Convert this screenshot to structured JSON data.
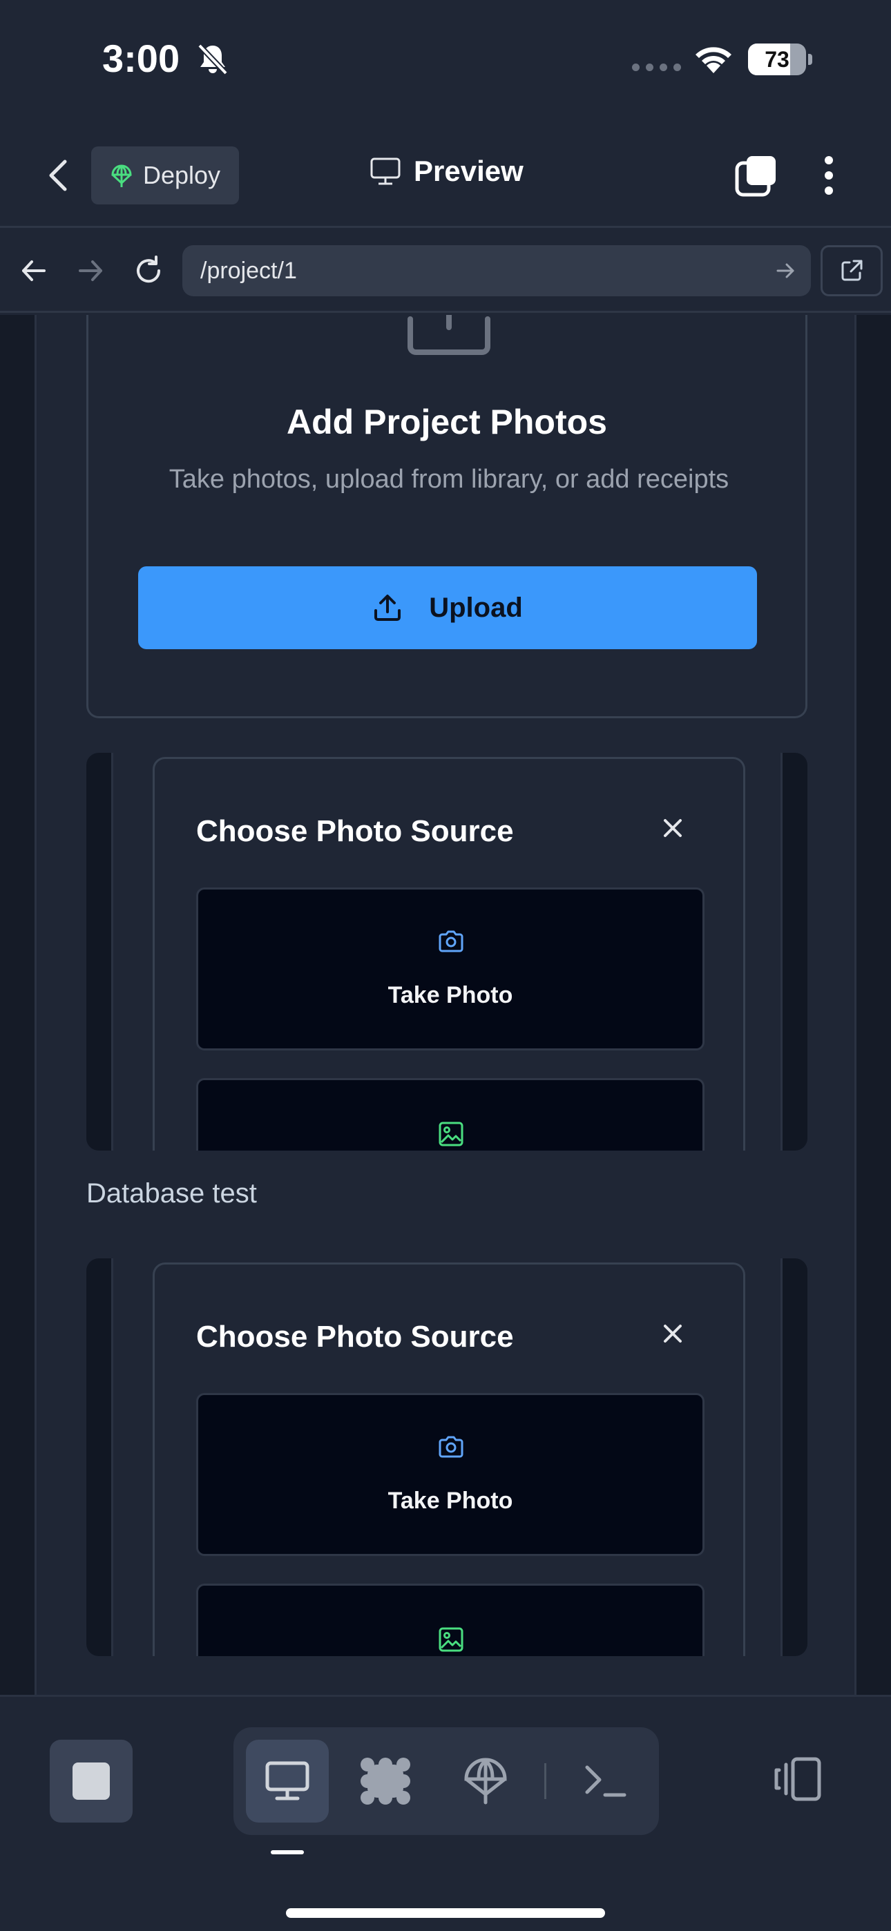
{
  "status_bar": {
    "time": "3:00",
    "battery_percent": "73",
    "battery_level": 0.73
  },
  "header": {
    "deploy_label": "Deploy",
    "title": "Preview"
  },
  "browser": {
    "url": "/project/1"
  },
  "upload_section": {
    "title": "Add Project Photos",
    "subtitle": "Take photos, upload from library, or add receipts",
    "button_label": "Upload"
  },
  "photo_source_modals": [
    {
      "title": "Choose Photo Source",
      "options": [
        {
          "label": "Take Photo",
          "icon": "camera-icon"
        },
        {
          "label": "",
          "icon": "image-icon"
        }
      ]
    },
    {
      "title": "Choose Photo Source",
      "options": [
        {
          "label": "Take Photo",
          "icon": "camera-icon"
        },
        {
          "label": "",
          "icon": "image-icon"
        }
      ]
    }
  ],
  "section_label": "Database test",
  "colors": {
    "accent": "#3b98fb",
    "background": "#1f2635",
    "option_bg": "#030816",
    "camera_icon": "#60a5fa",
    "image_icon": "#4ade80"
  }
}
